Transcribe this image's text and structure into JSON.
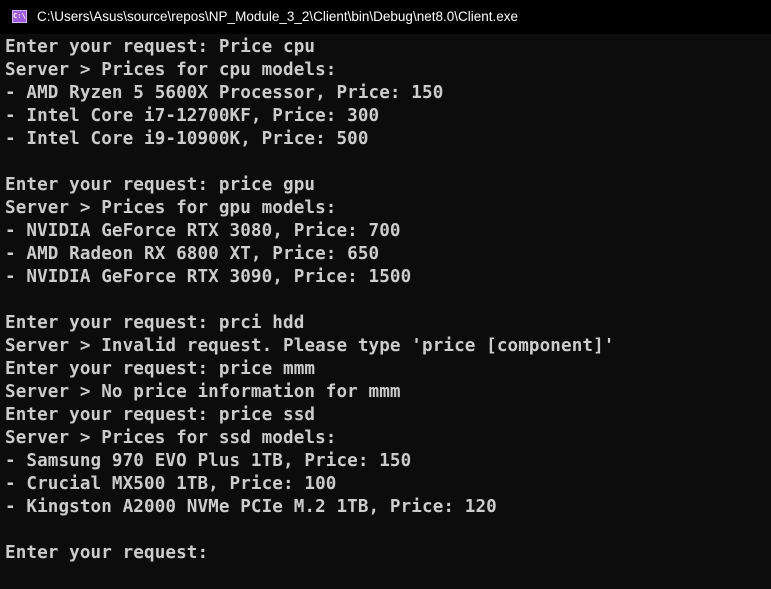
{
  "window": {
    "title": "C:\\Users\\Asus\\source\\repos\\NP_Module_3_2\\Client\\bin\\Debug\\net8.0\\Client.exe",
    "icon": "console-app-icon",
    "icon_glyph": "C:\\",
    "background_color": "#0c0c0c",
    "text_color": "#cccccc"
  },
  "console": {
    "lines": [
      "Enter your request: Price cpu",
      "Server > Prices for cpu models:",
      "- AMD Ryzen 5 5600X Processor, Price: 150",
      "- Intel Core i7-12700KF, Price: 300",
      "- Intel Core i9-10900K, Price: 500",
      "",
      "Enter your request: price gpu",
      "Server > Prices for gpu models:",
      "- NVIDIA GeForce RTX 3080, Price: 700",
      "- AMD Radeon RX 6800 XT, Price: 650",
      "- NVIDIA GeForce RTX 3090, Price: 1500",
      "",
      "Enter your request: prci hdd",
      "Server > Invalid request. Please type 'price [component]'",
      "Enter your request: price mmm",
      "Server > No price information for mmm",
      "Enter your request: price ssd",
      "Server > Prices for ssd models:",
      "- Samsung 970 EVO Plus 1TB, Price: 150",
      "- Crucial MX500 1TB, Price: 100",
      "- Kingston A2000 NVMe PCIe M.2 1TB, Price: 120",
      "",
      "Enter your request:"
    ]
  }
}
